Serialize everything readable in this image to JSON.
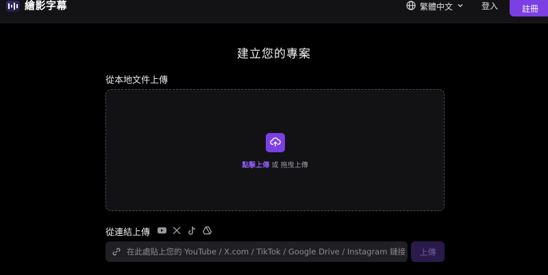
{
  "header": {
    "brand": "繪影字幕",
    "language": "繁體中文",
    "login": "登入",
    "signup": "註冊"
  },
  "main": {
    "title": "建立您的專案",
    "local_upload_label": "從本地文件上傳",
    "dropzone": {
      "click_text": "點擊上傳",
      "or_text": "或",
      "drag_text": "拖曳上傳"
    },
    "link_upload_label": "從連結上傳",
    "platform_icons": [
      "youtube-icon",
      "x-icon",
      "tiktok-icon",
      "google-drive-icon"
    ],
    "link_input_placeholder": "在此處貼上您的 YouTube / X.com / TikTok / Google Drive / Instagram 鏈接",
    "submit_label": "上傳"
  },
  "colors": {
    "accent": "#7b3fe4",
    "background": "#000000",
    "header_bg": "#131316"
  }
}
